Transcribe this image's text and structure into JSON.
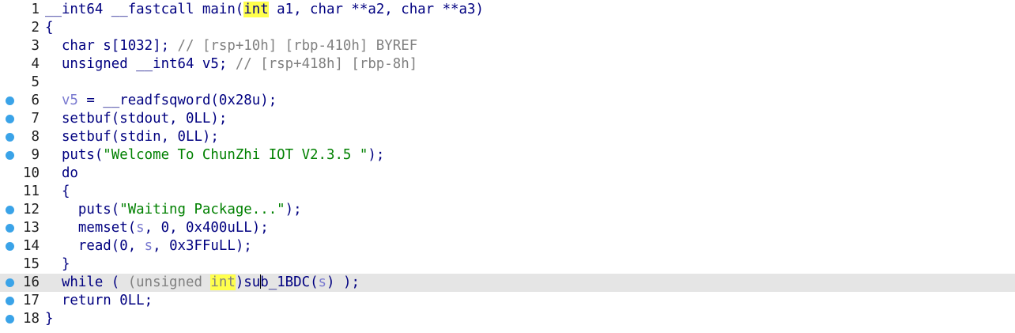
{
  "code_lines": [
    {
      "num": "1",
      "bp": false,
      "tokens": [
        [
          "pl",
          "__int64 __fastcall main("
        ],
        [
          "pl hl",
          "int"
        ],
        [
          "pl",
          " a1, char **a2, char **a3)"
        ]
      ]
    },
    {
      "num": "2",
      "bp": false,
      "tokens": [
        [
          "pl",
          "{"
        ]
      ]
    },
    {
      "num": "3",
      "bp": false,
      "tokens": [
        [
          "pl",
          "  char s[1032]; "
        ],
        [
          "cm",
          "// [rsp+10h] [rbp-410h] BYREF"
        ]
      ]
    },
    {
      "num": "4",
      "bp": false,
      "tokens": [
        [
          "pl",
          "  unsigned __int64 v5; "
        ],
        [
          "cm",
          "// [rsp+418h] [rbp-8h]"
        ]
      ]
    },
    {
      "num": "5",
      "bp": false,
      "tokens": [
        [
          "pl",
          ""
        ]
      ]
    },
    {
      "num": "6",
      "bp": true,
      "tokens": [
        [
          "lv",
          "  v5"
        ],
        [
          "pl",
          " = __readfsqword(0x28u);"
        ]
      ]
    },
    {
      "num": "7",
      "bp": true,
      "tokens": [
        [
          "pl",
          "  setbuf(stdout, 0LL);"
        ]
      ]
    },
    {
      "num": "8",
      "bp": true,
      "tokens": [
        [
          "pl",
          "  setbuf(stdin, 0LL);"
        ]
      ]
    },
    {
      "num": "9",
      "bp": true,
      "tokens": [
        [
          "pl",
          "  puts("
        ],
        [
          "st",
          "\"Welcome To ChunZhi IOT V2.3.5 \""
        ],
        [
          "pl",
          ");"
        ]
      ]
    },
    {
      "num": "10",
      "bp": false,
      "tokens": [
        [
          "pl",
          "  do"
        ]
      ]
    },
    {
      "num": "11",
      "bp": false,
      "tokens": [
        [
          "pl",
          "  {"
        ]
      ]
    },
    {
      "num": "12",
      "bp": true,
      "tokens": [
        [
          "pl",
          "    puts("
        ],
        [
          "st",
          "\"Waiting Package...\""
        ],
        [
          "pl",
          ");"
        ]
      ]
    },
    {
      "num": "13",
      "bp": true,
      "tokens": [
        [
          "pl",
          "    memset("
        ],
        [
          "lv",
          "s"
        ],
        [
          "pl",
          ", 0, 0x400uLL);"
        ]
      ]
    },
    {
      "num": "14",
      "bp": true,
      "tokens": [
        [
          "pl",
          "    read(0, "
        ],
        [
          "lv",
          "s"
        ],
        [
          "pl",
          ", 0x3FFuLL);"
        ]
      ]
    },
    {
      "num": "15",
      "bp": false,
      "tokens": [
        [
          "pl",
          "  }"
        ]
      ]
    },
    {
      "num": "16",
      "bp": true,
      "current": true,
      "tokens": [
        [
          "pl",
          "  while ( "
        ],
        [
          "cm",
          "(unsigned "
        ],
        [
          "cm hl",
          "int"
        ],
        [
          "pl",
          ")su"
        ],
        [
          "caret",
          ""
        ],
        [
          "pl",
          "b_1BDC("
        ],
        [
          "lv",
          "s"
        ],
        [
          "pl",
          ") );"
        ]
      ]
    },
    {
      "num": "17",
      "bp": true,
      "tokens": [
        [
          "pl",
          "  return 0LL;"
        ]
      ]
    },
    {
      "num": "18",
      "bp": true,
      "tokens": [
        [
          "pl",
          "}"
        ]
      ]
    }
  ]
}
